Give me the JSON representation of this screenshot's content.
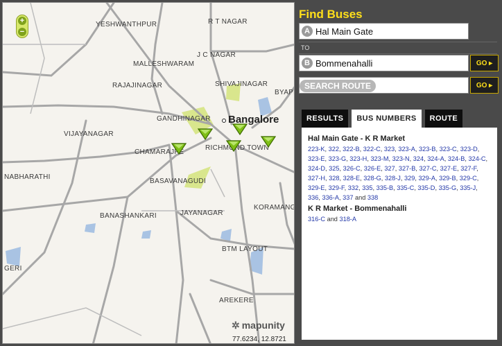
{
  "map": {
    "zoom_in": "+",
    "zoom_out": "−",
    "places": [
      "YESHWANTHPUR",
      "R T NAGAR",
      "J C NAGAR",
      "MALLESHWARAM",
      "RAJAJINAGAR",
      "SHIVAJINAGAR",
      "BYAPP",
      "GANDHINAGAR",
      "VIJAYANAGAR",
      "CHAMARAJPE",
      "RICHMOND TOWN",
      "NABHARATHI",
      "BASAVANAGUDI",
      "KORAMANGALA",
      "BANASHANKARI",
      "JAYANAGAR",
      "BTM LAYOUT",
      "GERI",
      "AREKERE"
    ],
    "city": "Bangalore",
    "logo": "mapunity",
    "coordinates": "77.6234, 12.8721",
    "colors": {
      "road": "#a7a7a7",
      "park": "#d9e68d",
      "water": "#a9c3e3",
      "marker": "#7fbf16"
    }
  },
  "panel": {
    "title": "Find Buses",
    "from_badge": "A",
    "from_value": "Hal Main Gate",
    "to_label": "TO",
    "to_badge": "B",
    "to_value": "Bommenahalli",
    "go_label": "GO ▸",
    "search_label": "SEARCH ROUTE",
    "tabs": [
      "RESULTS",
      "BUS NUMBERS",
      "ROUTE"
    ],
    "active_tab": "BUS NUMBERS",
    "segments": [
      {
        "title": "Hal Main Gate - K R Market",
        "buses": [
          "223-K",
          "322",
          "322-B",
          "322-C",
          "323",
          "323-A",
          "323-B",
          "323-C",
          "323-D",
          "323-E",
          "323-G",
          "323-H",
          "323-M",
          "323-N",
          "324",
          "324-A",
          "324-B",
          "324-C",
          "324-D",
          "325",
          "326-C",
          "326-E",
          "327",
          "327-B",
          "327-C",
          "327-E",
          "327-F",
          "327-H",
          "328",
          "328-E",
          "328-G",
          "328-J",
          "329",
          "329-A",
          "329-B",
          "329-C",
          "329-E",
          "329-F",
          "332",
          "335",
          "335-B",
          "335-C",
          "335-D",
          "335-G",
          "335-J",
          "336",
          "336-A",
          "337",
          "338"
        ]
      },
      {
        "title": "K R Market - Bommenahalli",
        "buses": [
          "316-C",
          "318-A"
        ]
      }
    ],
    "conjunction": "and"
  }
}
